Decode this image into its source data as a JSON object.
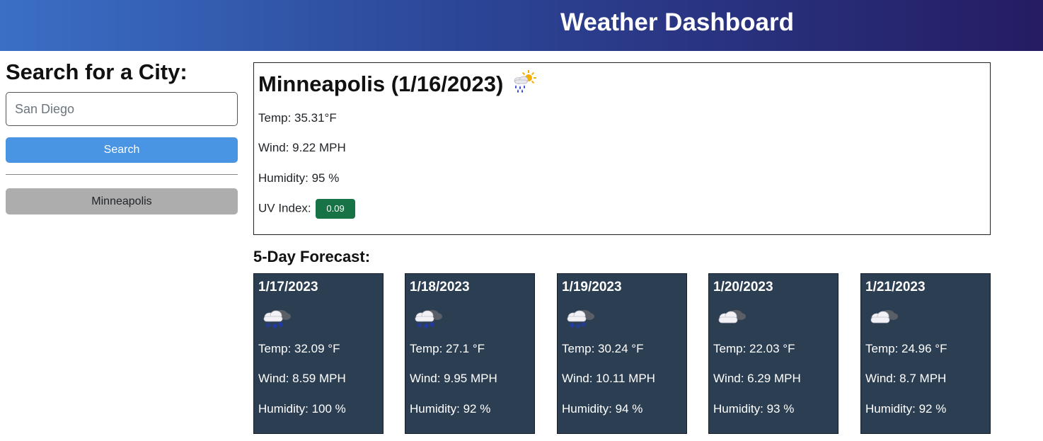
{
  "header": {
    "title": "Weather Dashboard"
  },
  "sidebar": {
    "heading": "Search for a City:",
    "search_placeholder": "San Diego",
    "search_button": "Search",
    "history": [
      "Minneapolis"
    ]
  },
  "current": {
    "title": "Minneapolis (1/16/2023)",
    "icon": "rain-sun-cloud-icon",
    "temp": "Temp: 35.31°F",
    "wind": "Wind: 9.22 MPH",
    "humidity": "Humidity: 95 %",
    "uv_label": "UV Index:",
    "uv_value": "0.09",
    "uv_color": "#177245"
  },
  "forecast": {
    "title": "5-Day Forecast:",
    "days": [
      {
        "date": "1/17/2023",
        "icon": "snow-cloud-icon",
        "temp": "Temp: 32.09 °F",
        "wind": "Wind: 8.59 MPH",
        "humidity": "Humidity: 100 %"
      },
      {
        "date": "1/18/2023",
        "icon": "snow-cloud-icon",
        "temp": "Temp: 27.1 °F",
        "wind": "Wind: 9.95 MPH",
        "humidity": "Humidity: 92 %"
      },
      {
        "date": "1/19/2023",
        "icon": "snow-cloud-icon",
        "temp": "Temp: 30.24 °F",
        "wind": "Wind: 10.11 MPH",
        "humidity": "Humidity: 94 %"
      },
      {
        "date": "1/20/2023",
        "icon": "cloud-icon",
        "temp": "Temp: 22.03 °F",
        "wind": "Wind: 6.29 MPH",
        "humidity": "Humidity: 93 %"
      },
      {
        "date": "1/21/2023",
        "icon": "cloud-icon",
        "temp": "Temp: 24.96 °F",
        "wind": "Wind: 8.7 MPH",
        "humidity": "Humidity: 92 %"
      }
    ]
  },
  "colors": {
    "header_gradient": [
      "#3a6fc5",
      "#2c4596",
      "#251c63"
    ],
    "search_button": "#4a94e4",
    "history_button": "#adadad",
    "card_bg": "#2c3e52"
  }
}
